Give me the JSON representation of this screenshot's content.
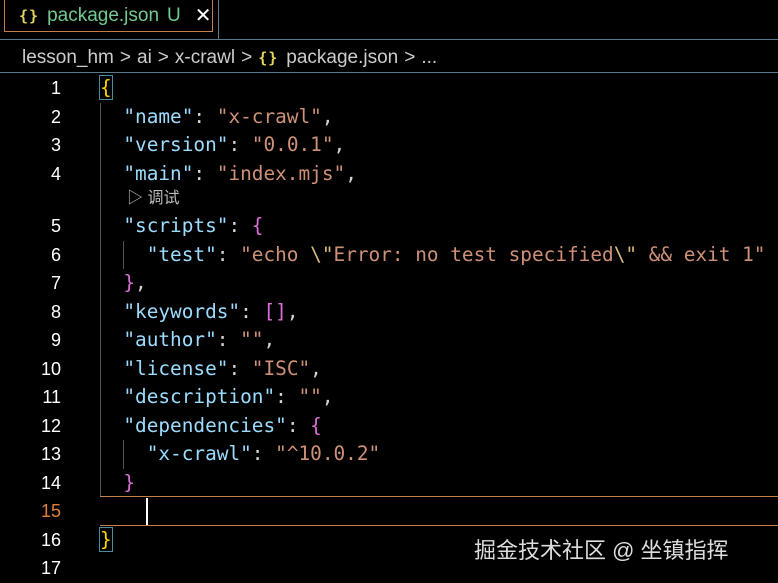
{
  "tab": {
    "icon": "{}",
    "name": "package.json",
    "status": "U",
    "close": "✕"
  },
  "breadcrumb": [
    "lesson_hm",
    "ai",
    "x-crawl",
    "package.json",
    "..."
  ],
  "breadcrumb_sep": ">",
  "codelens": "▷ 调试",
  "active_line": 15,
  "lines": [
    [
      [
        "y",
        "{"
      ]
    ],
    [
      [
        "p",
        "  "
      ],
      [
        "k",
        "\"name\""
      ],
      [
        "p",
        ": "
      ],
      [
        "s",
        "\"x-crawl\""
      ],
      [
        "p",
        ","
      ]
    ],
    [
      [
        "p",
        "  "
      ],
      [
        "k",
        "\"version\""
      ],
      [
        "p",
        ": "
      ],
      [
        "s",
        "\"0.0.1\""
      ],
      [
        "p",
        ","
      ]
    ],
    [
      [
        "p",
        "  "
      ],
      [
        "k",
        "\"main\""
      ],
      [
        "p",
        ": "
      ],
      [
        "s",
        "\"index.mjs\""
      ],
      [
        "p",
        ","
      ]
    ],
    [
      [
        "p",
        "  "
      ],
      [
        "k",
        "\"scripts\""
      ],
      [
        "p",
        ": "
      ],
      [
        "m",
        "{"
      ]
    ],
    [
      [
        "p",
        "    "
      ],
      [
        "k",
        "\"test\""
      ],
      [
        "p",
        ": "
      ],
      [
        "s",
        "\"echo "
      ],
      [
        "e",
        "\\\""
      ],
      [
        "s",
        "Error: no test specified"
      ],
      [
        "e",
        "\\\""
      ],
      [
        "s",
        " && exit 1\""
      ]
    ],
    [
      [
        "p",
        "  "
      ],
      [
        "m",
        "}"
      ],
      [
        "p",
        ","
      ]
    ],
    [
      [
        "p",
        "  "
      ],
      [
        "k",
        "\"keywords\""
      ],
      [
        "p",
        ": "
      ],
      [
        "m",
        "[]"
      ],
      [
        "p",
        ","
      ]
    ],
    [
      [
        "p",
        "  "
      ],
      [
        "k",
        "\"author\""
      ],
      [
        "p",
        ": "
      ],
      [
        "s",
        "\"\""
      ],
      [
        "p",
        ","
      ]
    ],
    [
      [
        "p",
        "  "
      ],
      [
        "k",
        "\"license\""
      ],
      [
        "p",
        ": "
      ],
      [
        "s",
        "\"ISC\""
      ],
      [
        "p",
        ","
      ]
    ],
    [
      [
        "p",
        "  "
      ],
      [
        "k",
        "\"description\""
      ],
      [
        "p",
        ": "
      ],
      [
        "s",
        "\"\""
      ],
      [
        "p",
        ","
      ]
    ],
    [
      [
        "p",
        "  "
      ],
      [
        "k",
        "\"dependencies\""
      ],
      [
        "p",
        ": "
      ],
      [
        "m",
        "{"
      ]
    ],
    [
      [
        "p",
        "    "
      ],
      [
        "k",
        "\"x-crawl\""
      ],
      [
        "p",
        ": "
      ],
      [
        "s",
        "\"^10.0.2\""
      ]
    ],
    [
      [
        "p",
        "  "
      ],
      [
        "m",
        "}"
      ]
    ],
    [],
    [
      [
        "y",
        "}"
      ]
    ],
    []
  ],
  "watermark": "掘金技术社区 @ 坐镇指挥"
}
